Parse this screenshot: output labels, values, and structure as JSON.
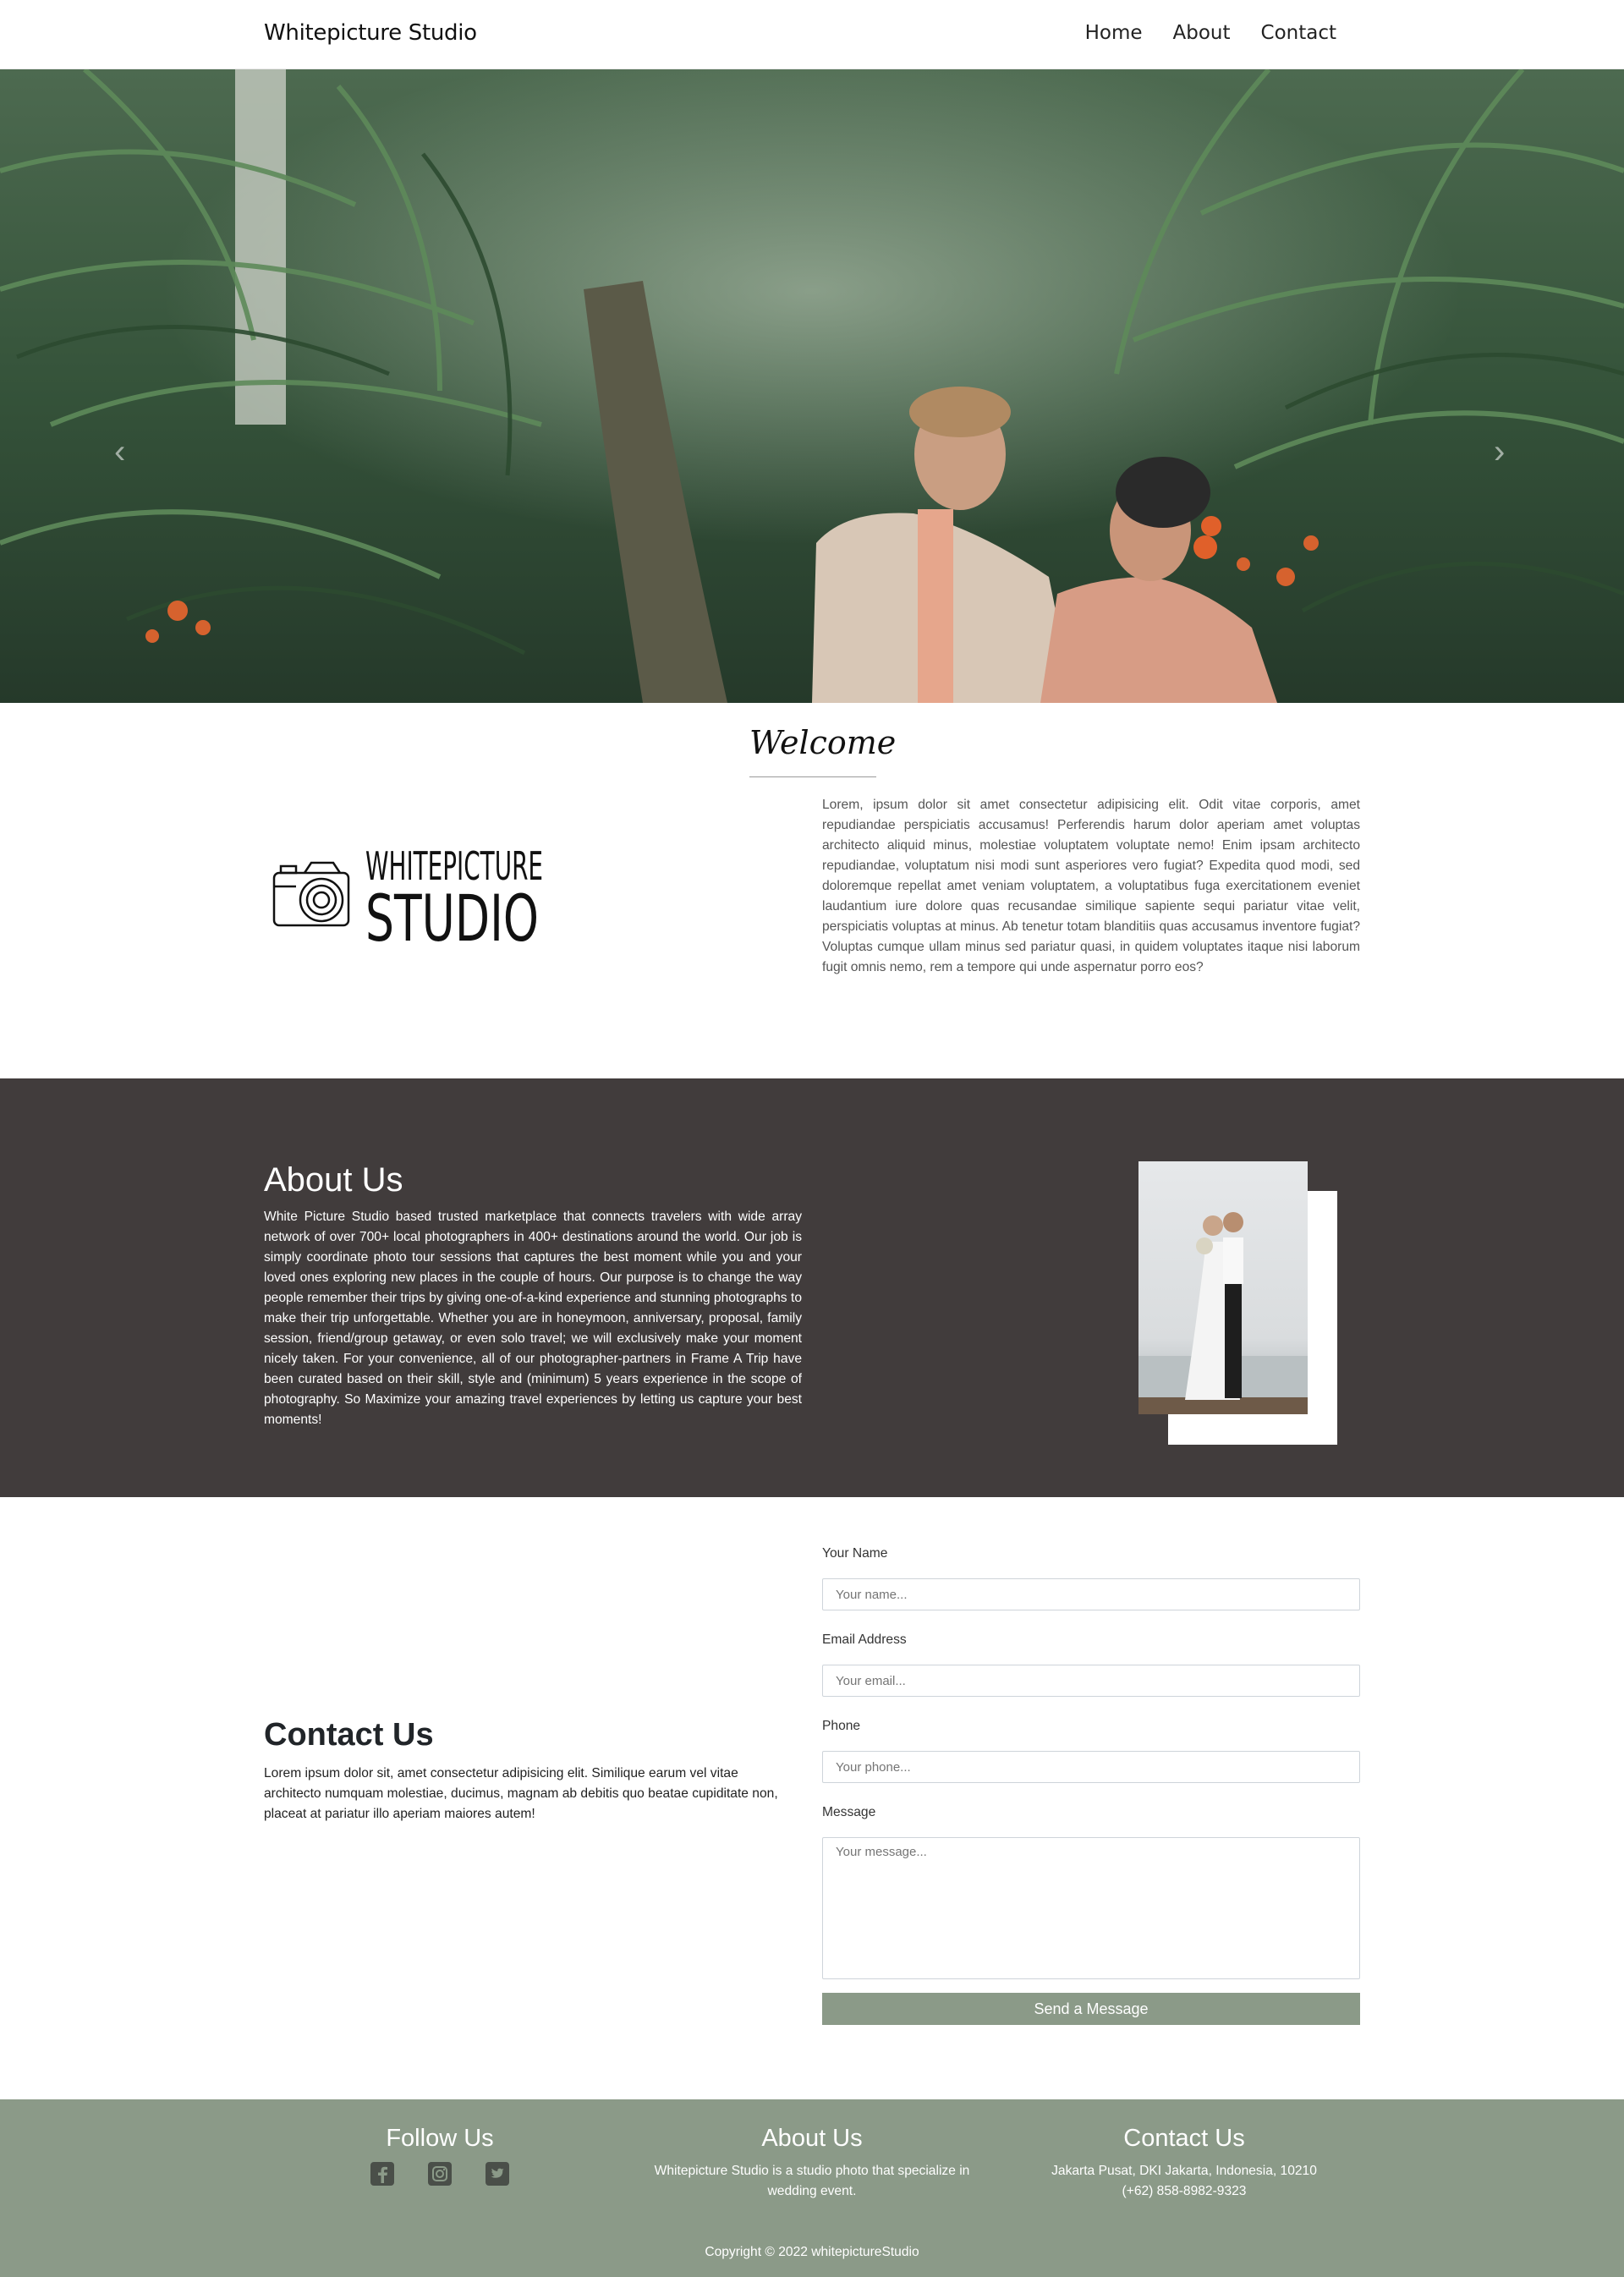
{
  "navbar": {
    "brand": "Whitepicture Studio",
    "links": [
      "Home",
      "About",
      "Contact"
    ]
  },
  "welcome": {
    "title": "Welcome",
    "logo_text_top": "WHITEPICTURE",
    "logo_text_bottom": "STUDIO",
    "body": "Lorem, ipsum dolor sit amet consectetur adipisicing elit. Odit vitae corporis, amet repudiandae perspiciatis accusamus! Perferendis harum dolor aperiam amet voluptas architecto aliquid minus, molestiae voluptatem voluptate nemo! Enim ipsam architecto repudiandae, voluptatum nisi modi sunt asperiores vero fugiat? Expedita quod modi, sed doloremque repellat amet veniam voluptatem, a voluptatibus fuga exercitationem eveniet laudantium iure dolore quas recusandae similique sapiente sequi pariatur vitae velit, perspiciatis voluptas at minus. Ab tenetur totam blanditiis quas accusamus inventore fugiat? Voluptas cumque ullam minus sed pariatur quasi, in quidem voluptates itaque nisi laborum fugit omnis nemo, rem a tempore qui unde aspernatur porro eos?"
  },
  "about": {
    "title": "About Us",
    "body": "White Picture Studio based trusted marketplace that connects travelers with wide array network of over 700+ local photographers in 400+ destinations around the world. Our job is simply coordinate photo tour sessions that captures the best moment while you and your loved ones exploring new places in the couple of hours. Our purpose is to change the way people remember their trips by giving one-of-a-kind experience and stunning photographs to make their trip unforgettable. Whether you are in honeymoon, anniversary, proposal, family session, friend/group getaway, or even solo travel; we will exclusively make your moment nicely taken. For your convenience, all of our photographer-partners in Frame A Trip have been curated based on their skill, style and (minimum) 5 years experience in the scope of photography. So Maximize your amazing travel experiences by letting us capture your best moments!"
  },
  "contact": {
    "title": "Contact Us",
    "body": "Lorem ipsum dolor sit, amet consectetur adipisicing elit. Similique earum vel vitae architecto numquam molestiae, ducimus, magnam ab debitis quo beatae cupiditate non, placeat at pariatur illo aperiam maiores autem!",
    "form": {
      "name_label": "Your Name",
      "name_placeholder": "Your name...",
      "email_label": "Email Address",
      "email_placeholder": "Your email...",
      "phone_label": "Phone",
      "phone_placeholder": "Your phone...",
      "message_label": "Message",
      "message_placeholder": "Your message...",
      "submit_label": "Send a Message"
    }
  },
  "footer": {
    "follow_title": "Follow Us",
    "social_icons": [
      "facebook-icon",
      "instagram-icon",
      "twitter-icon"
    ],
    "about_title": "About Us",
    "about_text": "Whitepicture Studio is a studio photo that specialize in wedding event.",
    "contact_title": "Contact Us",
    "address": "Jakarta Pusat, DKI Jakarta, Indonesia, 10210",
    "phone": "(+62) 858-8982-9323",
    "copyright": "Copyright © 2022 whitepictureStudio"
  },
  "colors": {
    "about_bg": "#413c3c",
    "accent_sage": "#8b9a88",
    "text_dark": "#212529"
  }
}
